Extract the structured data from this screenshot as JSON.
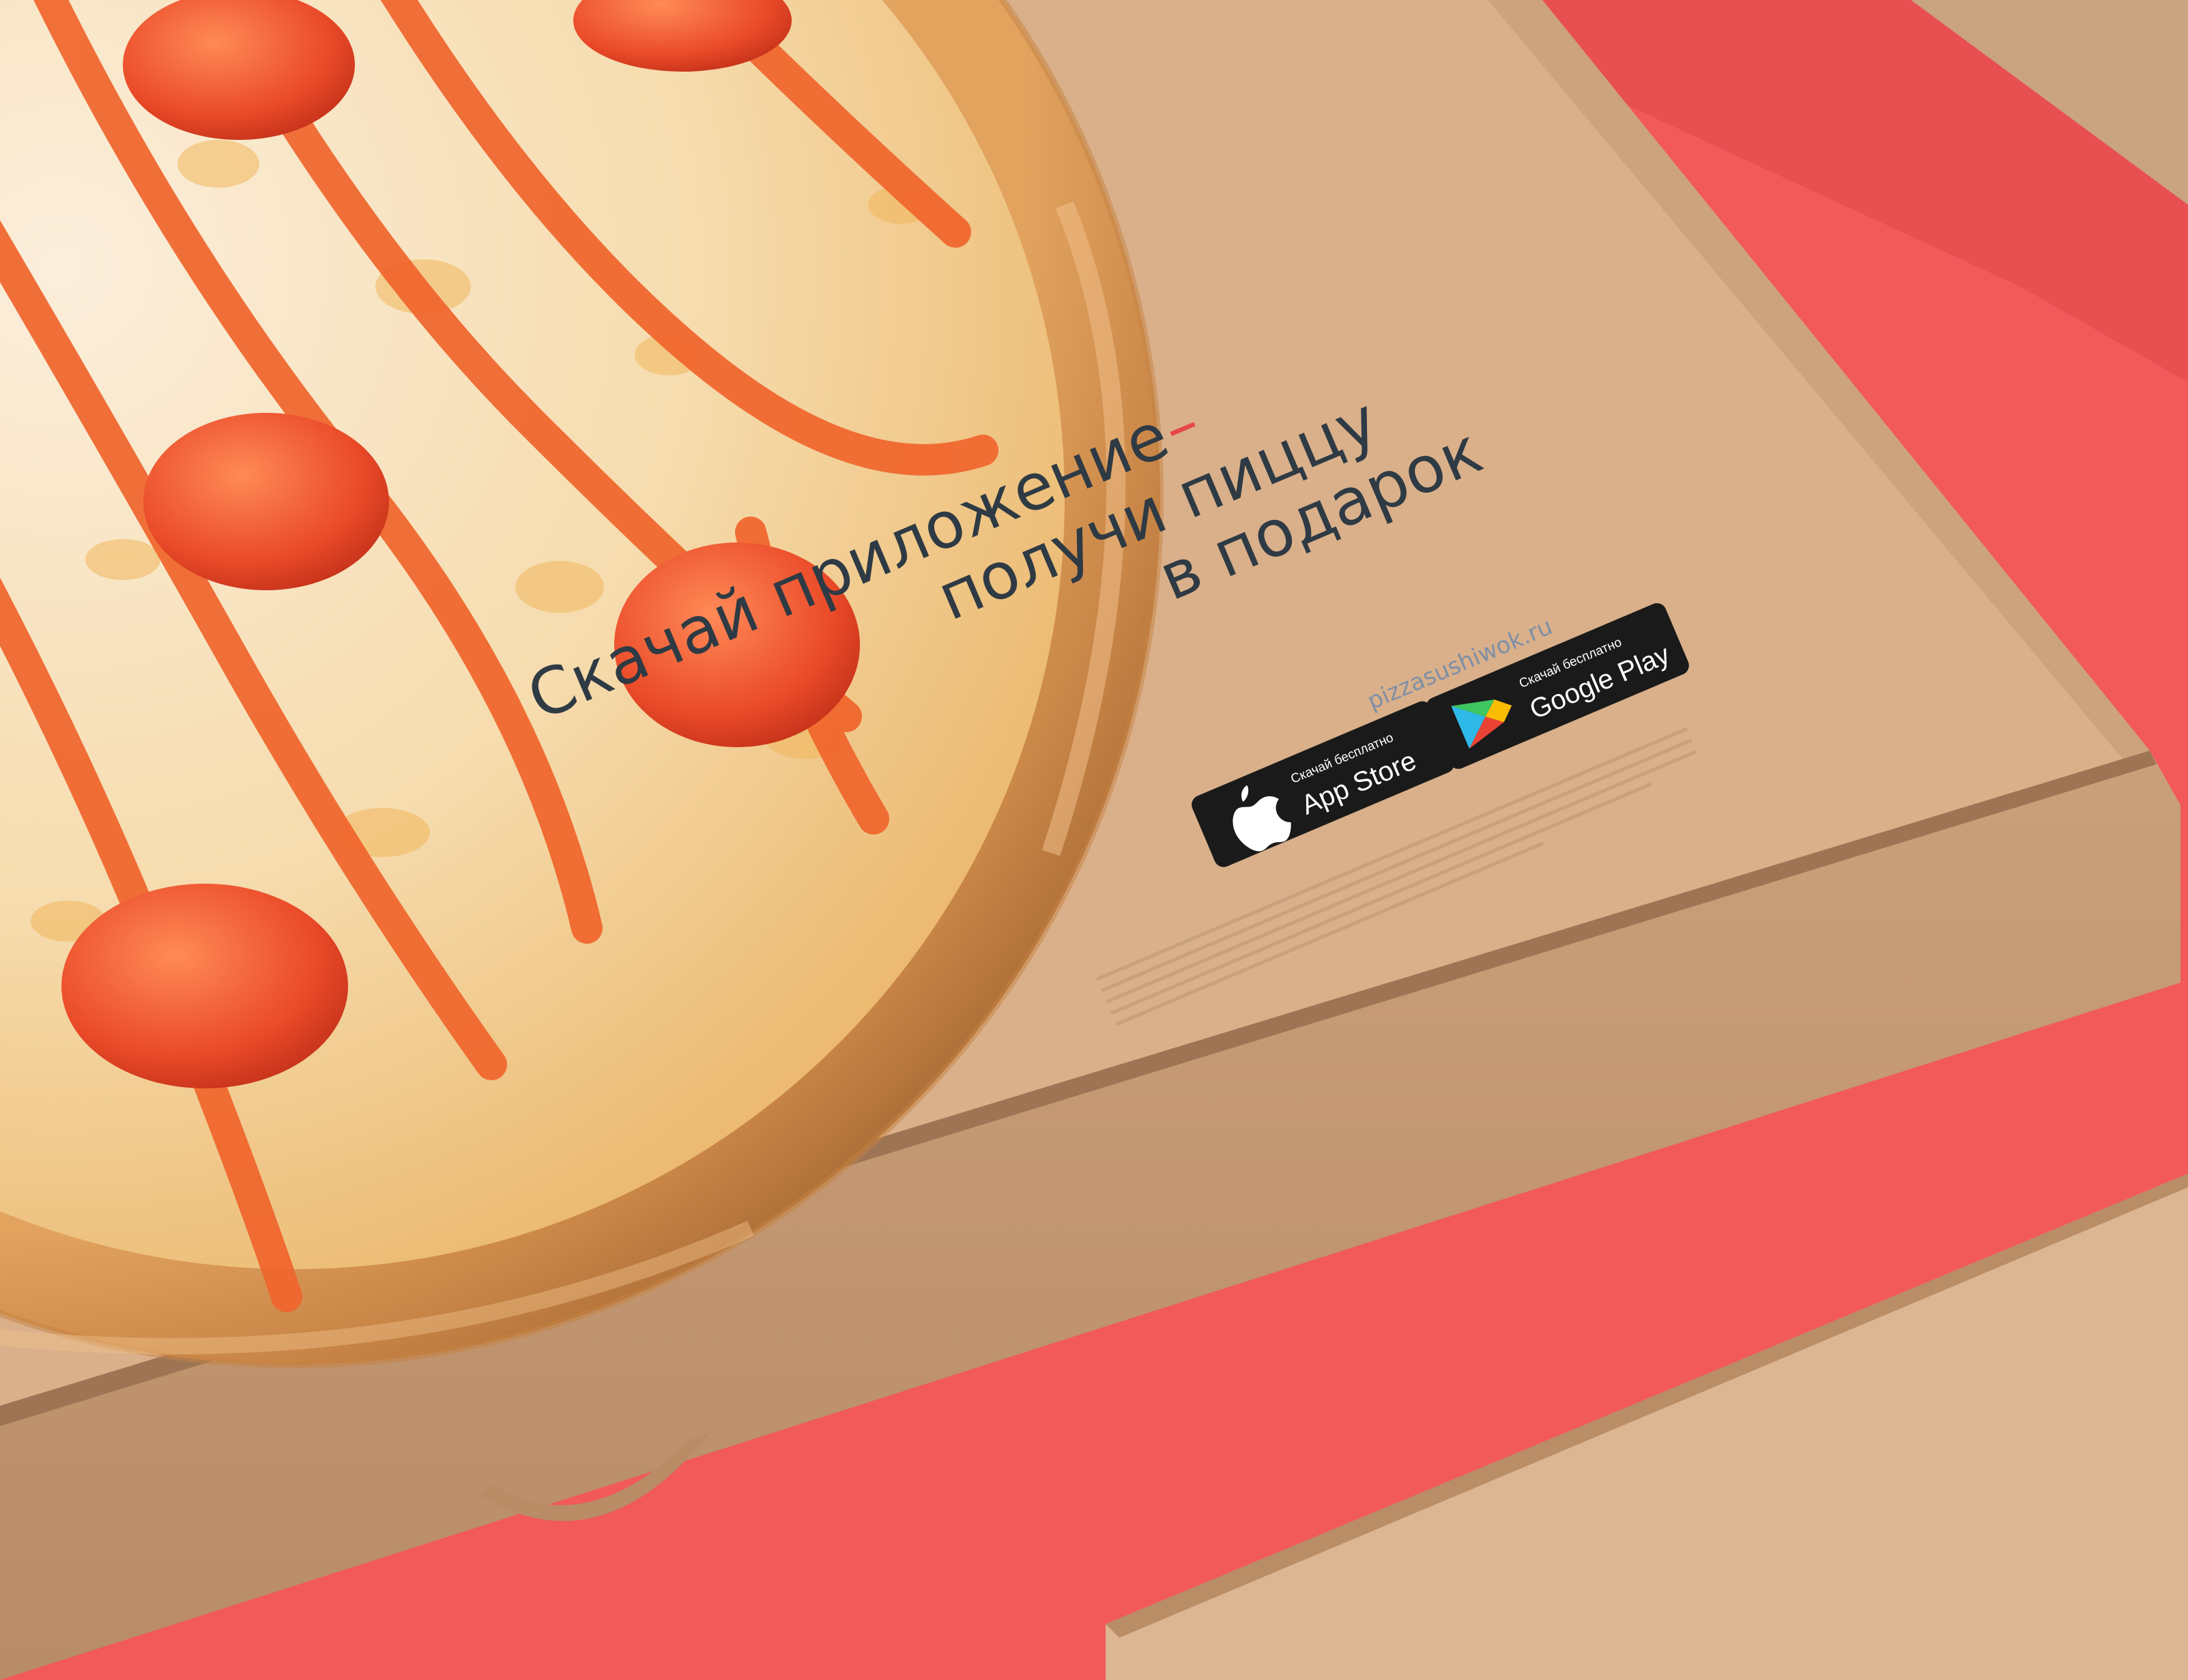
{
  "promo": {
    "line1": "Скачай приложение",
    "dash": "–",
    "line2": "получи пиццу",
    "line3": "в подарок"
  },
  "website": "pizzasushiwok.ru",
  "badges": {
    "app_store": {
      "small": "Скачай бесплатно",
      "big": "App Store",
      "icon": "apple-icon"
    },
    "google_play": {
      "small": "Скачай бесплатно",
      "big": "Google Play",
      "icon": "google-play-icon"
    }
  },
  "colors": {
    "background": "#f1595a",
    "cardboard": "#d9b08a",
    "text": "#2e3a44",
    "dash": "#e8474a",
    "badge": "#1a1a1a"
  }
}
